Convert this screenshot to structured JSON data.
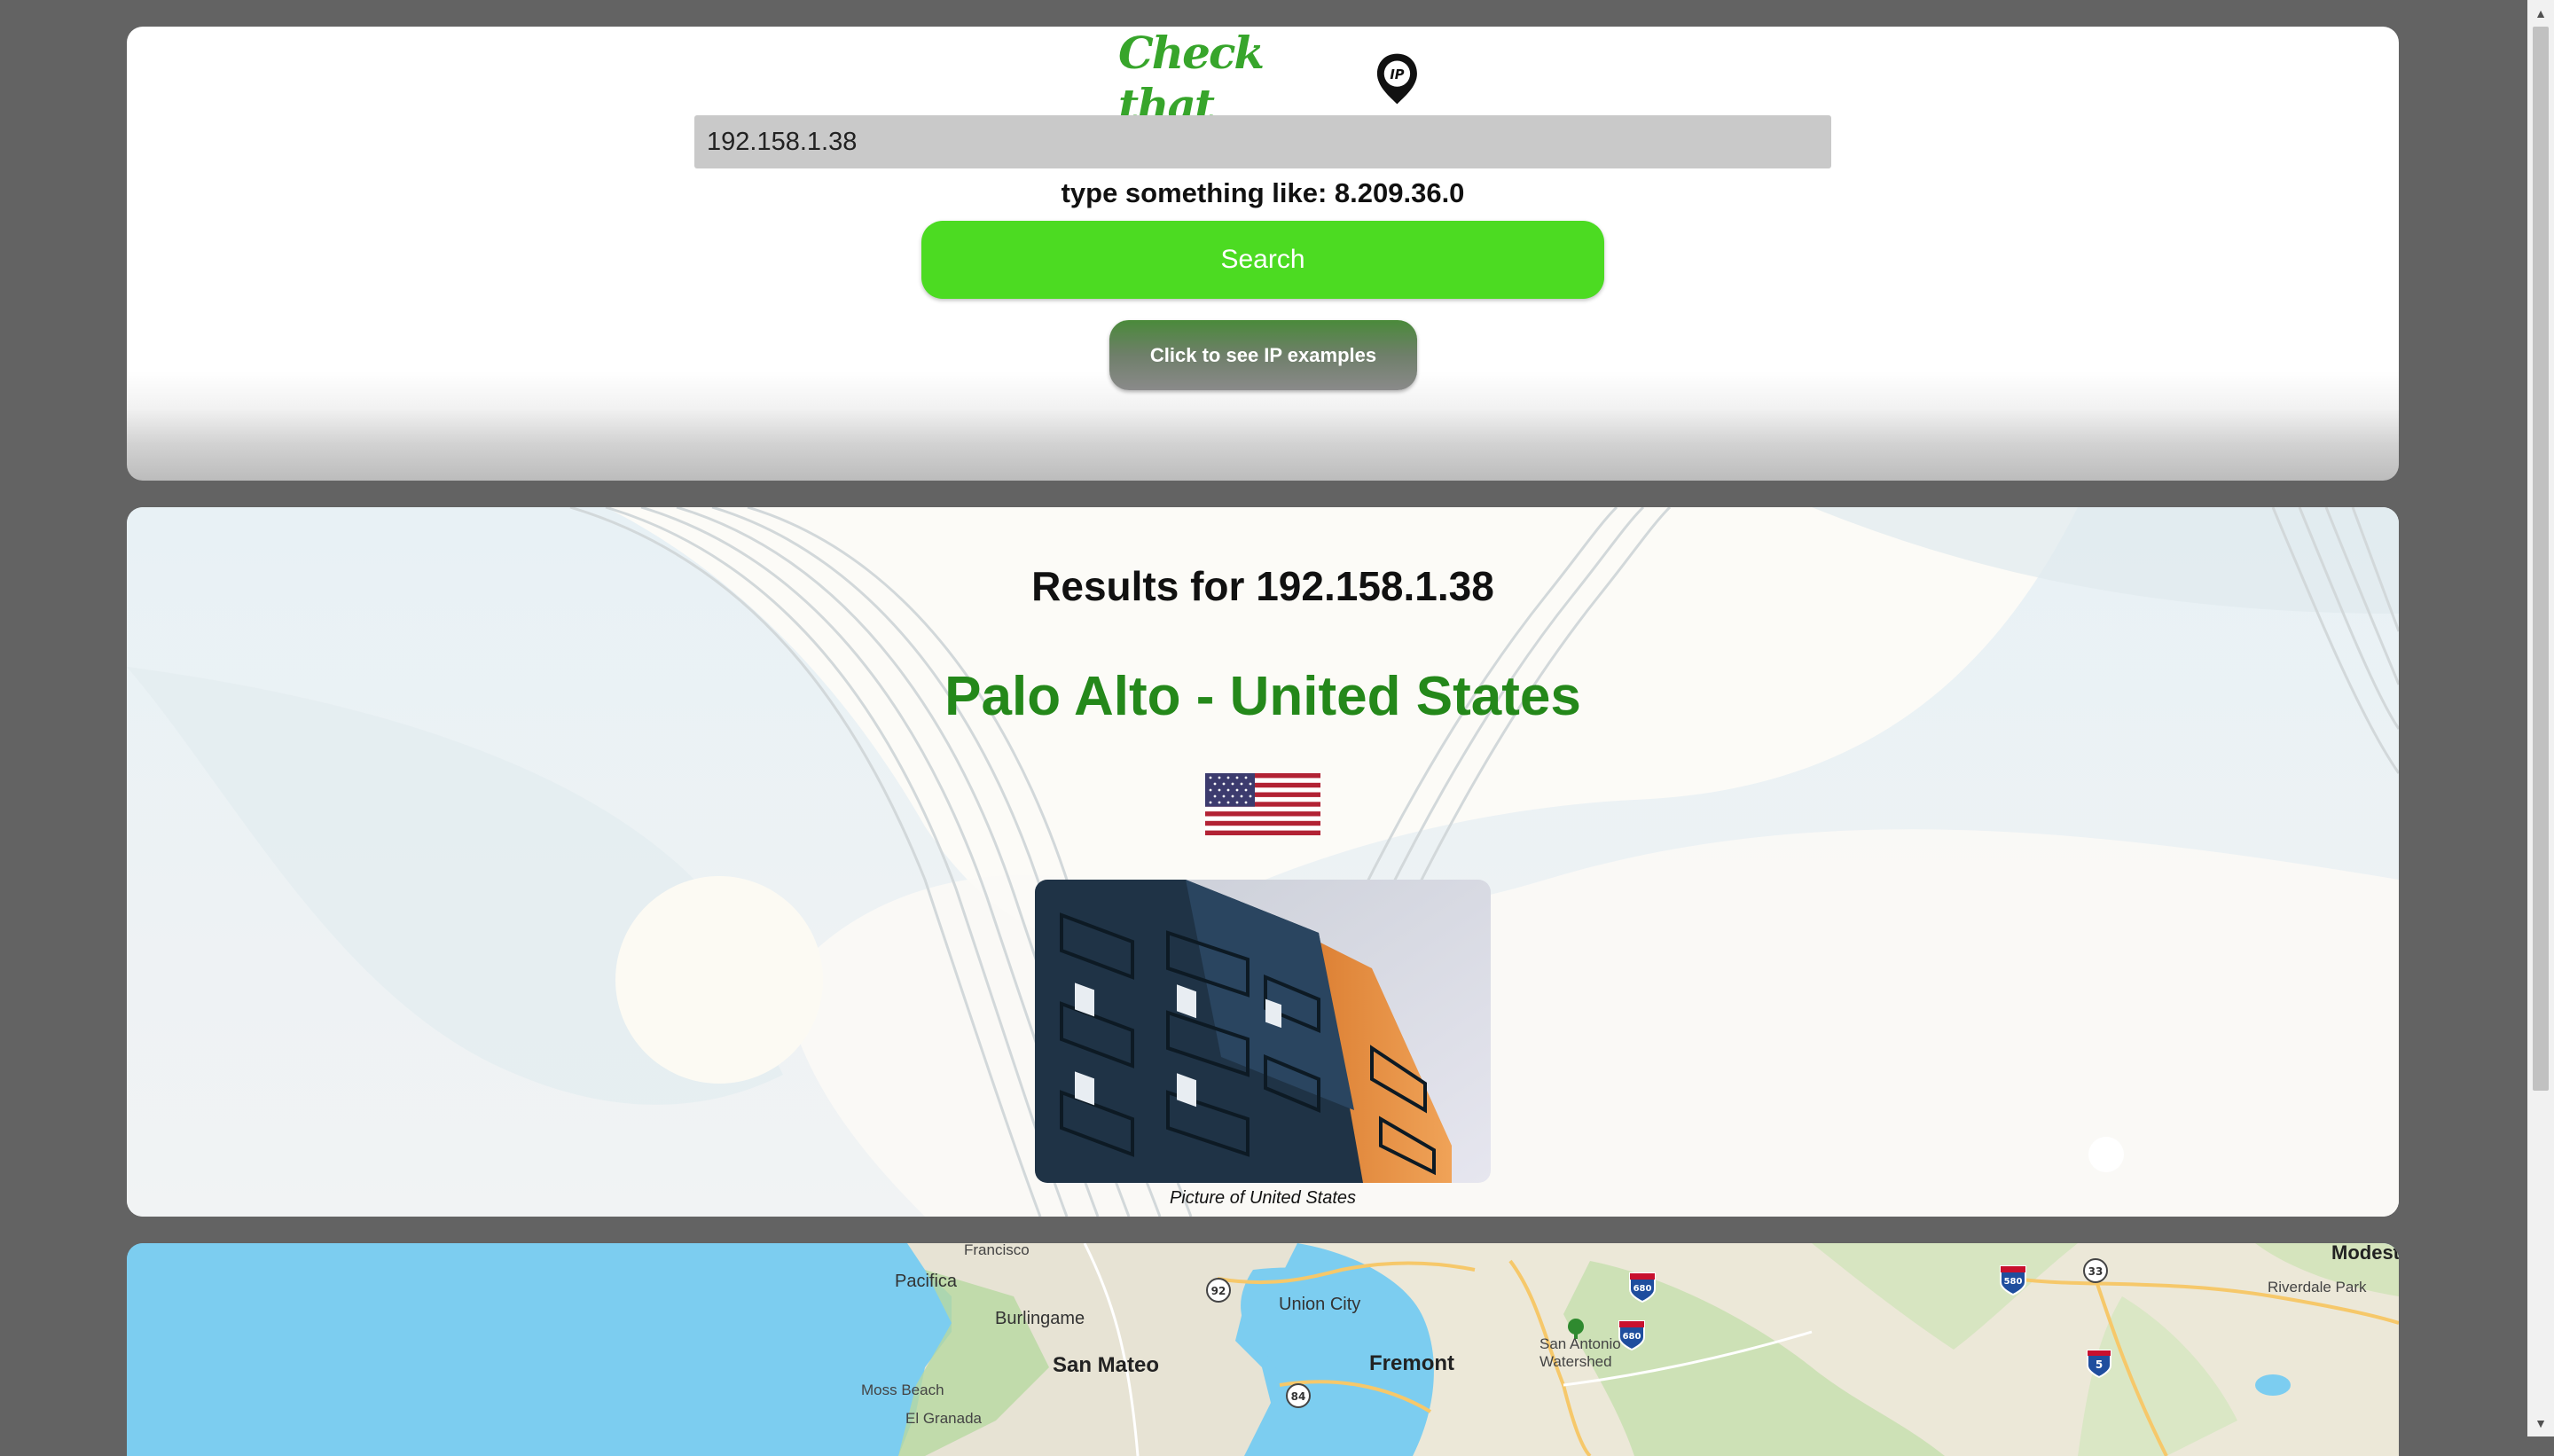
{
  "header": {
    "logo_text": "Check that",
    "logo_badge": "IP"
  },
  "search": {
    "value": "192.158.1.38",
    "hint": "type something like: 8.209.36.0",
    "search_label": "Search",
    "examples_label": "Click to see IP examples"
  },
  "results": {
    "title": "Results for 192.158.1.38",
    "location": "Palo Alto - United States",
    "flag": "us-flag",
    "caption": "Picture of United States"
  },
  "map": {
    "labels": {
      "francisco": "Francisco",
      "pacifica": "Pacifica",
      "burlingame": "Burlingame",
      "san_mateo": "San Mateo",
      "moss_beach": "Moss Beach",
      "el_granada": "El Granada",
      "union_city": "Union City",
      "fremont": "Fremont",
      "san_antonio": "San Antonio\nWatershed",
      "modesto": "Modest",
      "riverdale": "Riverdale Park"
    },
    "shields": {
      "i92": "92",
      "i84": "84",
      "i680a": "680",
      "i680b": "680",
      "i580": "580",
      "i5": "5",
      "i33": "33"
    }
  },
  "colors": {
    "brand_green": "#37a52b",
    "search_button": "#4cdb22",
    "location_text": "#24881a",
    "page_background": "#636363"
  }
}
